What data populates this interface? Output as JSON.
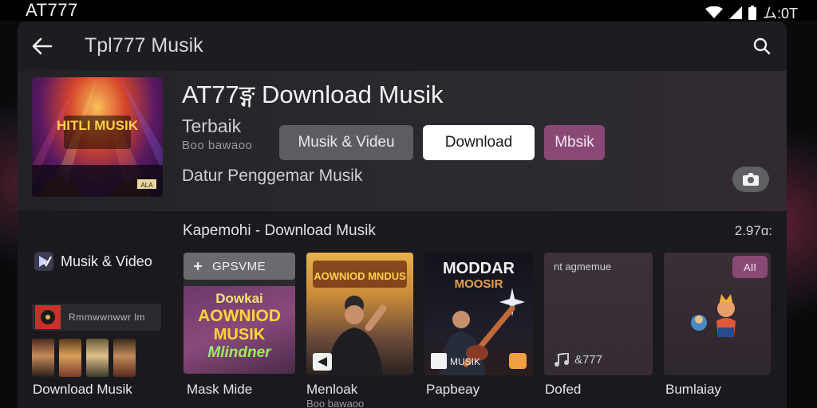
{
  "status_bar": {
    "title": "AT777",
    "time": "ム:0T"
  },
  "app_bar": {
    "title": "Tpl777 Musik"
  },
  "hero": {
    "title": "AT77ङ्ग Download Musik",
    "subtitle": "Terbaik",
    "subtext": "Boo bawaoo",
    "tagline": "Datur Penggemar Musik",
    "art_text": "HITLI MUSIK",
    "art_badge": "ALA"
  },
  "chips": [
    {
      "label": "Musik & Videu"
    },
    {
      "label": "Download"
    },
    {
      "label": "Mbsik"
    }
  ],
  "section": {
    "title": "Kapemohi - Download Musik",
    "count": "2.97ɑ:"
  },
  "sidebar": {
    "item_label": "Musik & Video",
    "row_text": "Rmmwwnwwr lm",
    "bottom_label": "Download Musik"
  },
  "cards": [
    {
      "caption": "Mask Mide",
      "top_label": "GPSVME",
      "art_text": [
        "Dowkai",
        "AOWNIOD",
        "MUSIK",
        "Mlindner"
      ]
    },
    {
      "caption": "Menloak",
      "caption2": "Boo bawaoo",
      "art_text": "AOWNIOD MNDUS"
    },
    {
      "caption": "Papbeay",
      "art_text": [
        "MODDAR",
        "MOOSIR"
      ],
      "badge_text": "MUSIK"
    },
    {
      "caption": "Dofed",
      "header_text": "nt agmemue",
      "footer_text": "&777"
    },
    {
      "caption": "Bumlaiay",
      "badge": "AII"
    }
  ],
  "colors": {
    "accent_purple": "#8a4877",
    "window_bg": "#1d1d21"
  }
}
